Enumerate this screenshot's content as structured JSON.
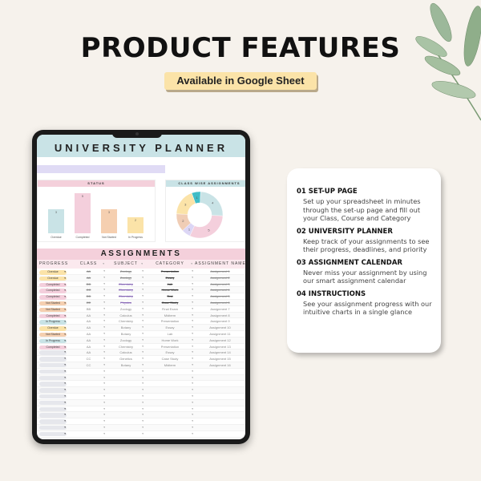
{
  "header": {
    "title": "PRODUCT FEATURES",
    "badge": "Available in Google Sheet"
  },
  "tablet": {
    "sheet_title": "UNIVERSITY PLANNER",
    "status_chart_title": "STATUS",
    "donut_chart_title": "CLASS WISE ASSIGNMENTS",
    "assignments_title": "ASSIGNMENTS",
    "columns": [
      "PROGRESS",
      "CLASS",
      "SUBJECT",
      "CATEGORY",
      "ASSIGNMENT NAME"
    ],
    "status_colors": {
      "Overdue": "#fbe3a8",
      "Completed": "#f4cfdc",
      "Not Started": "#f5cfb0",
      "In Progress": "#c9e3e6",
      "": "#e6e7ec"
    },
    "rows": [
      {
        "progress": "Overdue",
        "class": "AA",
        "subject": "Zoology",
        "category": "Presentation",
        "name": "Assignment 1",
        "done": true
      },
      {
        "progress": "Overdue",
        "class": "AA",
        "subject": "Zoology",
        "category": "Essay",
        "name": "Assignment 2",
        "done": true
      },
      {
        "progress": "Completed",
        "class": "DD",
        "subject": "Chemistry",
        "category": "Lab",
        "name": "Assignment 3",
        "done": true
      },
      {
        "progress": "Completed",
        "class": "CC",
        "subject": "Chemistry",
        "category": "Home Work",
        "name": "Assignment 4",
        "done": true
      },
      {
        "progress": "Completed",
        "class": "DD",
        "subject": "Chemistry",
        "category": "Test",
        "name": "Assignment 5",
        "done": true
      },
      {
        "progress": "Not Started",
        "class": "EE",
        "subject": "Physics",
        "category": "Case Study",
        "name": "Assignment 6",
        "done": true
      },
      {
        "progress": "Not Started",
        "class": "BB",
        "subject": "Zoology",
        "category": "Final Exam",
        "name": "Assignment 7",
        "done": false
      },
      {
        "progress": "Completed",
        "class": "AA",
        "subject": "Calculus",
        "category": "Midterm",
        "name": "Assignment 8",
        "done": false
      },
      {
        "progress": "In Progress",
        "class": "AA",
        "subject": "Chemistry",
        "category": "Presentation",
        "name": "Assignment 9",
        "done": false
      },
      {
        "progress": "Overdue",
        "class": "AA",
        "subject": "Botany",
        "category": "Essay",
        "name": "Assignment 10",
        "done": false
      },
      {
        "progress": "Not Started",
        "class": "AA",
        "subject": "Botany",
        "category": "Lab",
        "name": "Assignment 11",
        "done": false
      },
      {
        "progress": "In Progress",
        "class": "AA",
        "subject": "Zoology",
        "category": "Home Work",
        "name": "Assignment 12",
        "done": false
      },
      {
        "progress": "Completed",
        "class": "AA",
        "subject": "Chemistry",
        "category": "Presentation",
        "name": "Assignment 13",
        "done": false
      },
      {
        "progress": "",
        "class": "AA",
        "subject": "Calculus",
        "category": "Essay",
        "name": "Assignment 14",
        "done": false
      },
      {
        "progress": "",
        "class": "CC",
        "subject": "Genetics",
        "category": "Case Study",
        "name": "Assignment 15",
        "done": false
      },
      {
        "progress": "",
        "class": "CC",
        "subject": "Botany",
        "category": "Midterm",
        "name": "Assignment 16",
        "done": false
      },
      {
        "progress": "",
        "class": "",
        "subject": "",
        "category": "",
        "name": "",
        "done": false
      },
      {
        "progress": "",
        "class": "",
        "subject": "",
        "category": "",
        "name": "",
        "done": false
      },
      {
        "progress": "",
        "class": "",
        "subject": "",
        "category": "",
        "name": "",
        "done": false
      },
      {
        "progress": "",
        "class": "",
        "subject": "",
        "category": "",
        "name": "",
        "done": false
      },
      {
        "progress": "",
        "class": "",
        "subject": "",
        "category": "",
        "name": "",
        "done": false
      },
      {
        "progress": "",
        "class": "",
        "subject": "",
        "category": "",
        "name": "",
        "done": false
      },
      {
        "progress": "",
        "class": "",
        "subject": "",
        "category": "",
        "name": "",
        "done": false
      },
      {
        "progress": "",
        "class": "",
        "subject": "",
        "category": "",
        "name": "",
        "done": false
      },
      {
        "progress": "",
        "class": "",
        "subject": "",
        "category": "",
        "name": "",
        "done": false
      },
      {
        "progress": "",
        "class": "",
        "subject": "",
        "category": "",
        "name": "",
        "done": false
      },
      {
        "progress": "",
        "class": "",
        "subject": "",
        "category": "",
        "name": "",
        "done": false
      }
    ]
  },
  "chart_data": [
    {
      "type": "bar",
      "title": "STATUS",
      "categories": [
        "Overdue",
        "Completed",
        "Not Started",
        "In Progress"
      ],
      "values": [
        3,
        5,
        3,
        2
      ],
      "colors": [
        "#c9e3e6",
        "#f4cfdc",
        "#f5cfb0",
        "#fbe3a8"
      ],
      "ylim": [
        0,
        5
      ]
    },
    {
      "type": "pie",
      "title": "CLASS WISE ASSIGNMENTS",
      "donut": true,
      "values": [
        1,
        4,
        5,
        1,
        2,
        3
      ],
      "colors": [
        "#3fbcc6",
        "#c9e3e6",
        "#f4cfdc",
        "#dcd6f5",
        "#f0cdb5",
        "#fbe3a8"
      ]
    }
  ],
  "features": [
    {
      "heading": "01 SET-UP PAGE",
      "text": "Set up your spreadsheet in minutes through the set-up page and fill out your Class, Course and Category"
    },
    {
      "heading": "02 UNIVERSITY PLANNER",
      "text": "Keep track of your assignments to see their progress, deadlines, and priority"
    },
    {
      "heading": "03 ASSIGNMENT CALENDAR",
      "text": "Never miss your assignment by using our smart assignment calendar"
    },
    {
      "heading": "04 INSTRUCTIONS",
      "text": "See your assignment progress with our intuitive charts in a single glance"
    }
  ]
}
